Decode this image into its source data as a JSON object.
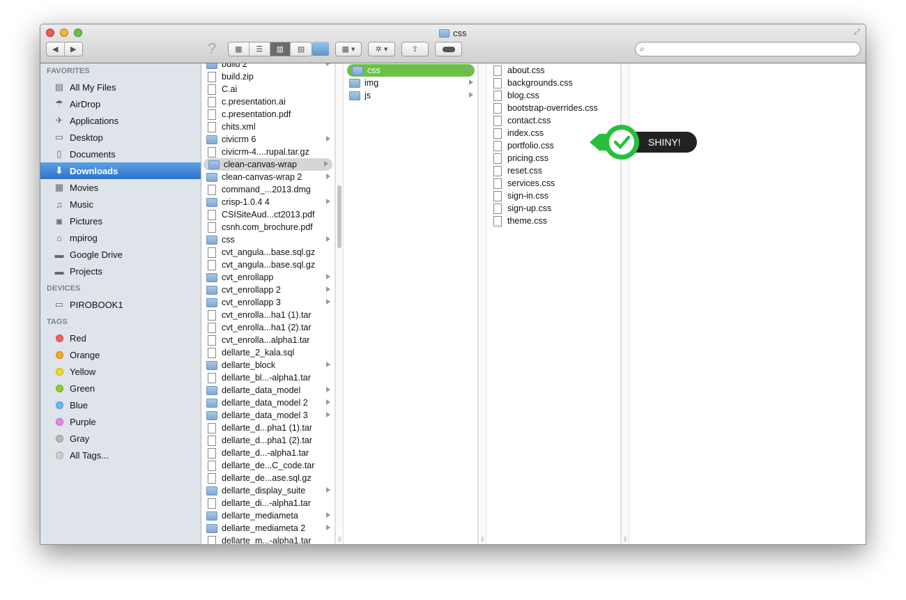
{
  "window": {
    "title": "css",
    "traffic_colors": [
      "#ee5a50",
      "#f4b43a",
      "#69c249"
    ]
  },
  "toolbar": {
    "back": "◀",
    "forward": "▶",
    "help": "?",
    "views": [
      "icon-view",
      "list-view",
      "column-view",
      "coverflow-view"
    ],
    "active_view": "column-view",
    "search_placeholder": ""
  },
  "sidebar": {
    "favorites_header": "FAVORITES",
    "favorites": [
      {
        "label": "All My Files",
        "icon": "all-files"
      },
      {
        "label": "AirDrop",
        "icon": "airdrop"
      },
      {
        "label": "Applications",
        "icon": "applications"
      },
      {
        "label": "Desktop",
        "icon": "desktop"
      },
      {
        "label": "Documents",
        "icon": "documents"
      },
      {
        "label": "Downloads",
        "icon": "downloads",
        "selected": true
      },
      {
        "label": "Movies",
        "icon": "movies"
      },
      {
        "label": "Music",
        "icon": "music"
      },
      {
        "label": "Pictures",
        "icon": "pictures"
      },
      {
        "label": "mpirog",
        "icon": "home"
      },
      {
        "label": "Google Drive",
        "icon": "folder"
      },
      {
        "label": "Projects",
        "icon": "folder"
      }
    ],
    "devices_header": "DEVICES",
    "devices": [
      {
        "label": "PIROBOOK1",
        "icon": "laptop"
      }
    ],
    "tags_header": "TAGS",
    "tags": [
      {
        "label": "Red",
        "color": "#f06060"
      },
      {
        "label": "Orange",
        "color": "#f5a623"
      },
      {
        "label": "Yellow",
        "color": "#f2dc1f"
      },
      {
        "label": "Green",
        "color": "#8fcf2a"
      },
      {
        "label": "Blue",
        "color": "#6ab8f0"
      },
      {
        "label": "Purple",
        "color": "#e08be8"
      },
      {
        "label": "Gray",
        "color": "#b8b8b8"
      },
      {
        "label": "All Tags...",
        "color": "#d0d0d0"
      }
    ]
  },
  "columns": [
    [
      {
        "n": "build 2",
        "f": 1
      },
      {
        "n": "build.zip"
      },
      {
        "n": "C.ai"
      },
      {
        "n": "c.presentation.ai"
      },
      {
        "n": "c.presentation.pdf"
      },
      {
        "n": "chits.xml"
      },
      {
        "n": "civicrm 6",
        "f": 1
      },
      {
        "n": "civicrm-4....rupal.tar.gz"
      },
      {
        "n": "clean-canvas-wrap",
        "f": 1,
        "s": "gray"
      },
      {
        "n": "clean-canvas-wrap 2",
        "f": 1
      },
      {
        "n": "command_...2013.dmg"
      },
      {
        "n": "crisp-1.0.4 4",
        "f": 1
      },
      {
        "n": "CSISiteAud...ct2013.pdf"
      },
      {
        "n": "csnh.com_brochure.pdf"
      },
      {
        "n": "css",
        "f": 1
      },
      {
        "n": "cvt_angula...base.sql.gz"
      },
      {
        "n": "cvt_angula...base.sql.gz"
      },
      {
        "n": "cvt_enrollapp",
        "f": 1
      },
      {
        "n": "cvt_enrollapp 2",
        "f": 1
      },
      {
        "n": "cvt_enrollapp 3",
        "f": 1
      },
      {
        "n": "cvt_enrolla...ha1 (1).tar"
      },
      {
        "n": "cvt_enrolla...ha1 (2).tar"
      },
      {
        "n": "cvt_enrolla...alpha1.tar"
      },
      {
        "n": "dellarte_2_kala.sql"
      },
      {
        "n": "dellarte_block",
        "f": 1
      },
      {
        "n": "dellarte_bl...-alpha1.tar"
      },
      {
        "n": "dellarte_data_model",
        "f": 1
      },
      {
        "n": "dellarte_data_model 2",
        "f": 1
      },
      {
        "n": "dellarte_data_model 3",
        "f": 1
      },
      {
        "n": "dellarte_d...pha1 (1).tar"
      },
      {
        "n": "dellarte_d...pha1 (2).tar"
      },
      {
        "n": "dellarte_d...-alpha1.tar"
      },
      {
        "n": "dellarte_de...C_code.tar"
      },
      {
        "n": "dellarte_de...ase.sql.gz"
      },
      {
        "n": "dellarte_display_suite",
        "f": 1
      },
      {
        "n": "dellarte_di...-alpha1.tar"
      },
      {
        "n": "dellarte_mediameta",
        "f": 1
      },
      {
        "n": "dellarte_mediameta 2",
        "f": 1
      },
      {
        "n": "dellarte_m...-alpha1.tar"
      }
    ],
    [
      {
        "n": "css",
        "f": 1,
        "s": "green"
      },
      {
        "n": "img",
        "f": 1
      },
      {
        "n": "js",
        "f": 1
      }
    ],
    [
      {
        "n": "about.css"
      },
      {
        "n": "backgrounds.css"
      },
      {
        "n": "blog.css"
      },
      {
        "n": "bootstrap-overrides.css"
      },
      {
        "n": "contact.css"
      },
      {
        "n": "index.css"
      },
      {
        "n": "portfolio.css"
      },
      {
        "n": "pricing.css"
      },
      {
        "n": "reset.css"
      },
      {
        "n": "services.css"
      },
      {
        "n": "sign-in.css"
      },
      {
        "n": "sign-up.css"
      },
      {
        "n": "theme.css"
      }
    ]
  ],
  "badge": {
    "label": "SHINY!",
    "color": "#27c03d"
  }
}
